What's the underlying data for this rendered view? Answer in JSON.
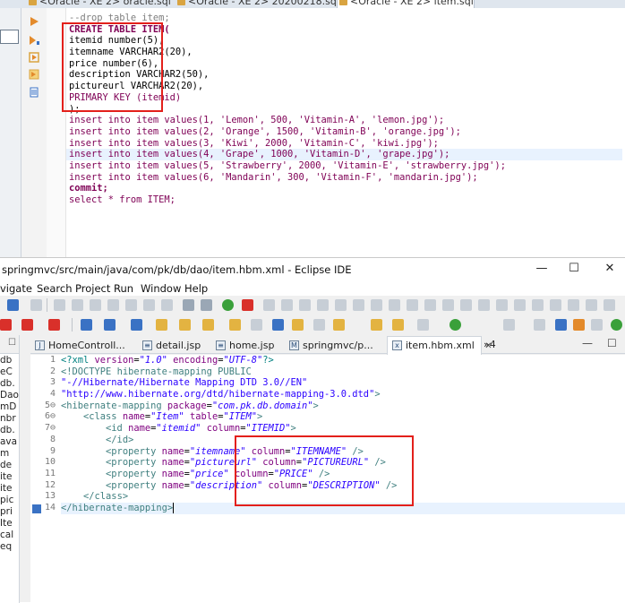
{
  "top_window": {
    "tabs": [
      {
        "label": "<Oracle - XE 2> oracle.sql"
      },
      {
        "label": "<Oracle - XE 2> 20200218.sql"
      },
      {
        "label": "<Oracle - XE 2> item.sql"
      }
    ],
    "sql_lines": [
      "--drop table item;",
      "CREATE TABLE ITEM(",
      "itemid number(5),",
      "itemname VARCHAR2(20),",
      "price number(6),",
      "description VARCHAR2(50),",
      "pictureurl VARCHAR2(20),",
      "PRIMARY KEY (itemid)",
      ");",
      "insert into item values(1, 'Lemon', 500, 'Vitamin-A', 'lemon.jpg');",
      "insert into item values(2, 'Orange', 1500, 'Vitamin-B', 'orange.jpg');",
      "insert into item values(3, 'Kiwi', 2000, 'Vitamin-C', 'kiwi.jpg');",
      "insert into item values(4, 'Grape', 1000, 'Vitamin-D', 'grape.jpg');",
      "insert into item values(5, 'Strawberry', 2000, 'Vitamin-E', 'strawberry.jpg');",
      "insert into item values(6, 'Mandarin', 300, 'Vitamin-F', 'mandarin.jpg');",
      "commit;",
      "select * from ITEM;"
    ],
    "highlighted_line_index": 12
  },
  "eclipse": {
    "title": "springmvc/src/main/java/com/pk/db/dao/item.hbm.xml - Eclipse IDE",
    "window_buttons": {
      "minimize": "—",
      "maximize": "☐",
      "close": "✕"
    },
    "menu": [
      "vigate",
      "Search",
      "Project",
      "Run",
      "Window",
      "Help"
    ],
    "package_explorer_items": [
      "db",
      "eC",
      "db.",
      "Dao",
      "mD",
      "nbr",
      "db.",
      "ava",
      "m",
      "de",
      "ite",
      "ite",
      "pic",
      "pri",
      "Ite",
      "cal",
      "eq"
    ],
    "editor_tabs": [
      {
        "label": "HomeControll...",
        "icon": "J"
      },
      {
        "label": "detail.jsp",
        "icon": "≡"
      },
      {
        "label": "home.jsp",
        "icon": "≡"
      },
      {
        "label": "springmvc/p...",
        "icon": "M"
      },
      {
        "label": "item.hbm.xml",
        "icon": "x",
        "active": true,
        "close": "✕"
      }
    ],
    "tabs_overflow": "»4",
    "line_numbers": [
      "1",
      "2",
      "3",
      "4",
      "5⊖",
      "6⊖",
      "7⊖",
      "8",
      "9",
      "10",
      "11",
      "12",
      "13",
      "14"
    ]
  },
  "colors": {
    "red_box": "#e3201b",
    "keyword": "#7f0055",
    "xml_tag": "#3f7f7f",
    "xml_attr": "#7f007f",
    "xml_value": "#2a00ff"
  }
}
